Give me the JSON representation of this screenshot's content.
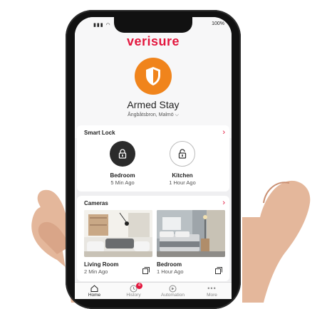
{
  "status_bar": {
    "time": "",
    "battery": "100%"
  },
  "brand": {
    "logo": "verisure",
    "color": "#e3173e"
  },
  "alarm": {
    "state": "Armed Stay",
    "location": "Ångbåtsbron, Malmö",
    "accent": "#f0841c"
  },
  "smart_lock": {
    "title": "Smart Lock",
    "locks": [
      {
        "name": "Bedroom",
        "time": "5 Min Ago",
        "state": "locked"
      },
      {
        "name": "Kitchen",
        "time": "1 Hour Ago",
        "state": "unlocked"
      }
    ]
  },
  "cameras": {
    "title": "Cameras",
    "items": [
      {
        "name": "Living Room",
        "time": "2 Min Ago"
      },
      {
        "name": "Bedroom",
        "time": "1 Hour Ago"
      }
    ]
  },
  "tabs": [
    {
      "label": "Home",
      "active": true
    },
    {
      "label": "History",
      "badge": "4"
    },
    {
      "label": "Automation"
    },
    {
      "label": "More"
    }
  ]
}
